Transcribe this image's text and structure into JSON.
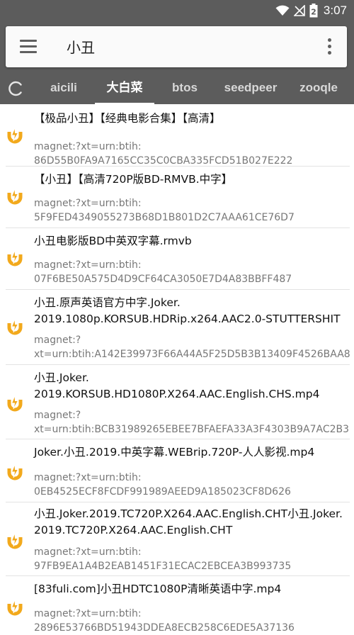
{
  "status_bar": {
    "time": "3:07",
    "battery_level": "2"
  },
  "search": {
    "query": "小丑",
    "menu_icon": "hamburger-menu-icon",
    "more_icon": "more-vert-icon"
  },
  "tabs": [
    {
      "label": "aicili",
      "active": false
    },
    {
      "label": "大白菜",
      "active": true
    },
    {
      "label": "btos",
      "active": false
    },
    {
      "label": "seedpeer",
      "active": false
    },
    {
      "label": "zooqle",
      "active": false
    }
  ],
  "accent_color": "#f2a91c",
  "results": [
    {
      "title": "【极品小丑】【经典电影合集】【高清】",
      "magnet": "magnet:?xt=urn:btih:\n86D55B0FA9A7165CC35C0CBA335FCD51B027E222"
    },
    {
      "title": "【小丑】【高清720P版BD-RMVB.中字】",
      "magnet": "magnet:?xt=urn:btih:\n5F9FED4349055273B68D1B801D2C7AAA61CE76D7"
    },
    {
      "title": "小丑电影版BD中英双字幕.rmvb",
      "magnet": "magnet:?xt=urn:btih:\n07F6BE50A575D4D9CF64CA3050E7D4A83BBFF487"
    },
    {
      "title": "小丑.原声英语官方中字.Joker.\n2019.1080p.KORSUB.HDRip.x264.AAC2.0-STUTTERSHIT",
      "magnet": "magnet:?\nxt=urn:btih:A142E39973F66A44A5F25D5B3B13409F4526BAA8"
    },
    {
      "title": "小丑.Joker.\n2019.KORSUB.HD1080P.X264.AAC.English.CHS.mp4",
      "magnet": "magnet:?\nxt=urn:btih:BCB31989265EBEE7BFAEFA33A3F4303B9A7AC2B3"
    },
    {
      "title": "Joker.小丑.2019.中英字幕.WEBrip.720P-人人影视.mp4",
      "magnet": "magnet:?xt=urn:btih:\n0EB4525ECF8FCDF991989AEED9A185023CF8D626"
    },
    {
      "title": "小丑.Joker.2019.TC720P.X264.AAC.English.CHT小丑.Joker.\n2019.TC720P.X264.AAC.English.CHT",
      "magnet": "magnet:?xt=urn:btih:\n97FB9EA1A4B2EAB1451F31ECAC2EBCEA3B993735"
    },
    {
      "title": "[83fuli.com]小丑HDTC1080P清晰英语中字.mp4",
      "magnet": "magnet:?xt=urn:btih:\n2896E53766BD51943DDEA8ECB258C6EDE5A37136"
    }
  ]
}
